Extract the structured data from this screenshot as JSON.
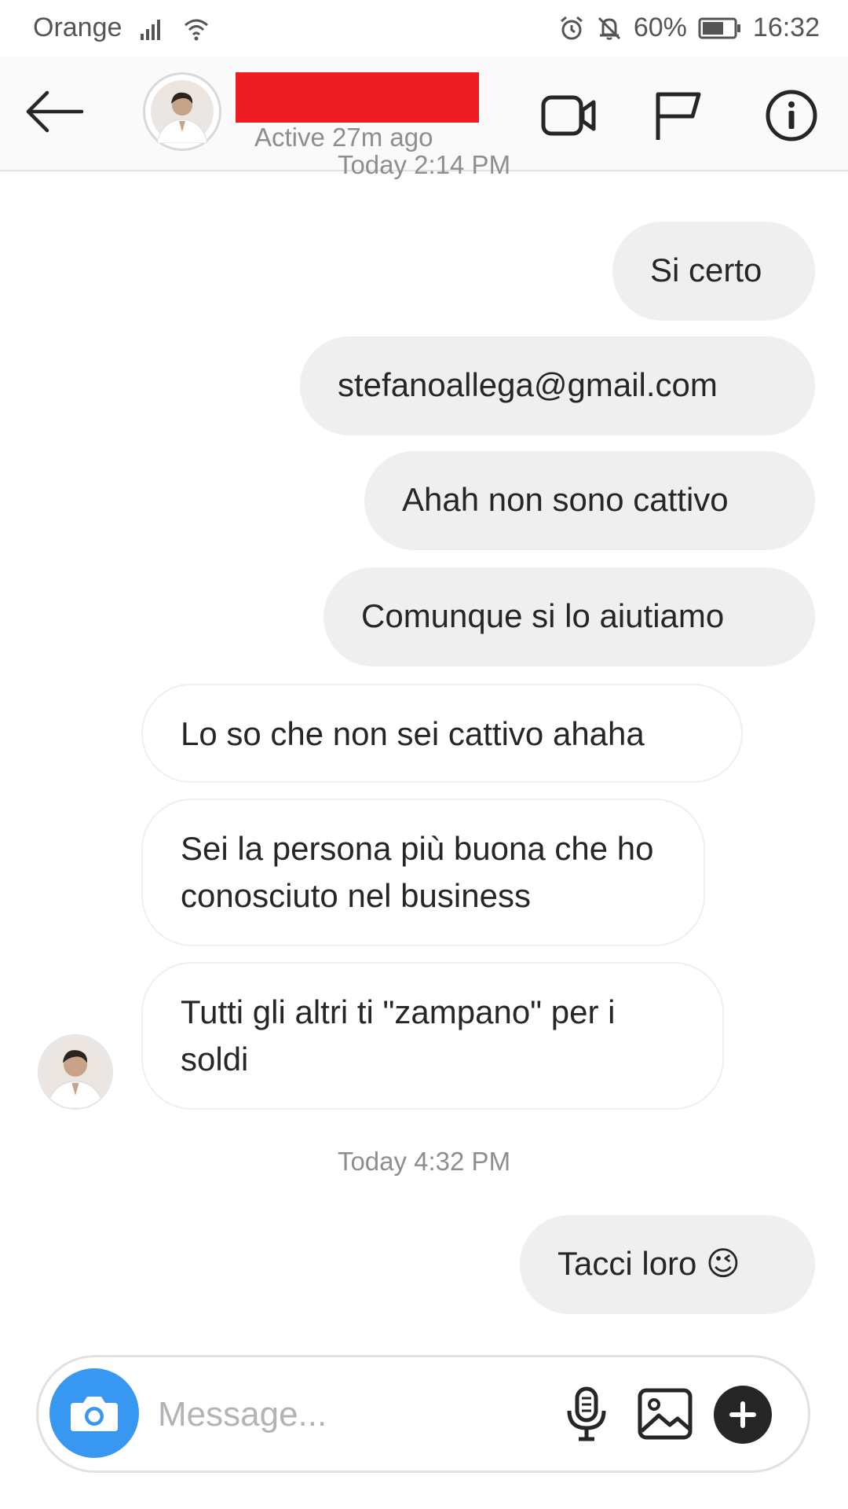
{
  "status_bar": {
    "carrier": "Orange",
    "battery": "60%",
    "time": "16:32",
    "icons": [
      "signal-icon",
      "wifi-icon",
      "alarm-icon",
      "mute-icon",
      "battery-icon"
    ]
  },
  "header": {
    "active_status": "Active 27m ago",
    "icons": [
      "back-arrow-icon",
      "video-call-icon",
      "flag-icon",
      "info-icon"
    ]
  },
  "conversation": {
    "timestamp_top": "Today 2:14 PM",
    "messages": [
      {
        "sender": "me",
        "text": "Si certo"
      },
      {
        "sender": "me",
        "text": "stefanoallega@gmail.com"
      },
      {
        "sender": "me",
        "text": "Ahah non sono cattivo"
      },
      {
        "sender": "me",
        "text": "Comunque si lo aiutiamo"
      },
      {
        "sender": "them",
        "text": "Lo so che non sei cattivo ahaha"
      },
      {
        "sender": "them",
        "text": "Sei la persona più buona che ho conosciuto nel business"
      },
      {
        "sender": "them",
        "text": "Tutti gli altri ti \"zampano\" per i soldi"
      }
    ],
    "timestamp_bottom": "Today 4:32 PM",
    "last_message": {
      "sender": "me",
      "text": "Tacci loro 😉"
    }
  },
  "composer": {
    "placeholder": "Message...",
    "value": "",
    "icons": [
      "camera-icon",
      "microphone-icon",
      "gallery-icon",
      "plus-icon"
    ]
  },
  "colors": {
    "redaction": "#ed1c24",
    "camera_button": "#3897f0",
    "outgoing_bubble": "#efefef",
    "secondary_text": "#8e8e8e"
  }
}
